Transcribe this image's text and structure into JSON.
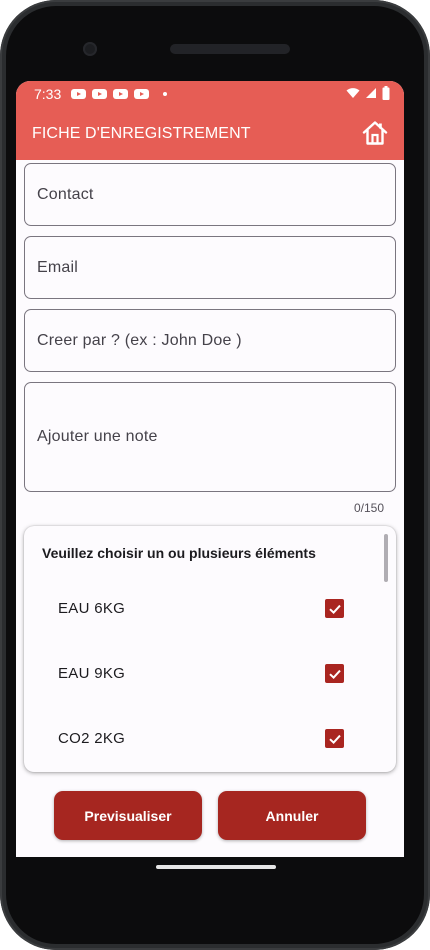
{
  "status_bar": {
    "time": "7:33",
    "notification_icons": [
      "youtube-icon",
      "youtube-icon",
      "youtube-icon",
      "youtube-icon"
    ],
    "indicators": [
      "wifi-icon",
      "signal-icon",
      "battery-icon"
    ]
  },
  "app_bar": {
    "title": "FICHE D'ENREGISTREMENT",
    "action_icon": "home-icon",
    "background_color": "#e65d55"
  },
  "form": {
    "contact_placeholder": "Contact",
    "email_placeholder": "Email",
    "created_by_placeholder": "Creer par ? (ex : John Doe )",
    "note_placeholder": "Ajouter une note",
    "note_counter": "0/150"
  },
  "selection": {
    "title": "Veuillez choisir un ou plusieurs éléments",
    "options": [
      {
        "label": "EAU 6KG",
        "checked": true
      },
      {
        "label": "EAU 9KG",
        "checked": true
      },
      {
        "label": "CO2 2KG",
        "checked": true
      }
    ],
    "check_color": "#a92520"
  },
  "actions": {
    "preview_label": "Previsualiser",
    "cancel_label": "Annuler",
    "button_color": "#a62620"
  }
}
